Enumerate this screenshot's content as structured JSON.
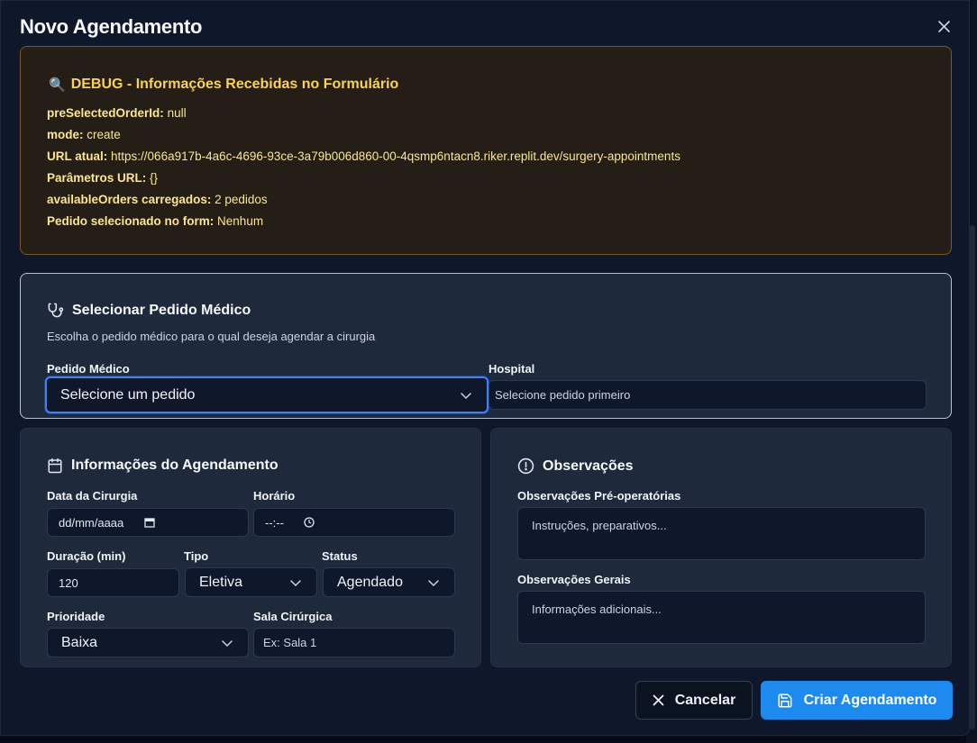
{
  "dialog": {
    "title": "Novo Agendamento",
    "close_label": "×"
  },
  "debug": {
    "icon": "magnifier-emoji",
    "glyph": "🔍",
    "title": "DEBUG - Informações Recebidas no Formulário",
    "lines": [
      {
        "key": "preSelectedOrderId:",
        "value": "null"
      },
      {
        "key": "mode:",
        "value": "create"
      },
      {
        "key": "URL atual:",
        "value": "https://066a917b-4a6c-4696-93ce-3a79b006d860-00-4qsmp6ntacn8.riker.replit.dev/surgery-appointments"
      },
      {
        "key": "Parâmetros URL:",
        "value": "{}"
      },
      {
        "key": "availableOrders carregados:",
        "value": "2 pedidos"
      },
      {
        "key": "Pedido selecionado no form:",
        "value": "Nenhum"
      }
    ]
  },
  "order_section": {
    "icon": "stethoscope-icon",
    "title": "Selecionar Pedido Médico",
    "description": "Escolha o pedido médico para o qual deseja agendar a cirurgia",
    "order_label": "Pedido Médico",
    "order_value": "Selecione um pedido",
    "hospital_label": "Hospital",
    "hospital_value": "Selecione pedido primeiro"
  },
  "schedule_section": {
    "icon": "calendar-icon",
    "title": "Informações do Agendamento",
    "date_label": "Data da Cirurgia",
    "date_value": "dd/mm/aaaa",
    "time_label": "Horário",
    "time_value": "--:--",
    "duration_label": "Duração (min)",
    "duration_value": "120",
    "type_label": "Tipo",
    "type_value": "Eletiva",
    "status_label": "Status",
    "status_value": "Agendado",
    "priority_label": "Prioridade",
    "priority_value": "Baixa",
    "room_label": "Sala Cirúrgica",
    "room_placeholder": "Ex: Sala 1"
  },
  "notes_section": {
    "icon": "alert-circle-icon",
    "title": "Observações",
    "pre_label": "Observações Pré-operatórias",
    "pre_placeholder": "Instruções, preparativos...",
    "general_label": "Observações Gerais",
    "general_placeholder": "Informações adicionais..."
  },
  "footer": {
    "cancel_label": "Cancelar",
    "submit_label": "Criar Agendamento"
  },
  "colors": {
    "accent": "#1d8af0",
    "debug_text": "#fcd34d",
    "debug_border": "#7a5a22",
    "card_bg": "#1e293b",
    "focus_ring": "#3b82f6"
  }
}
